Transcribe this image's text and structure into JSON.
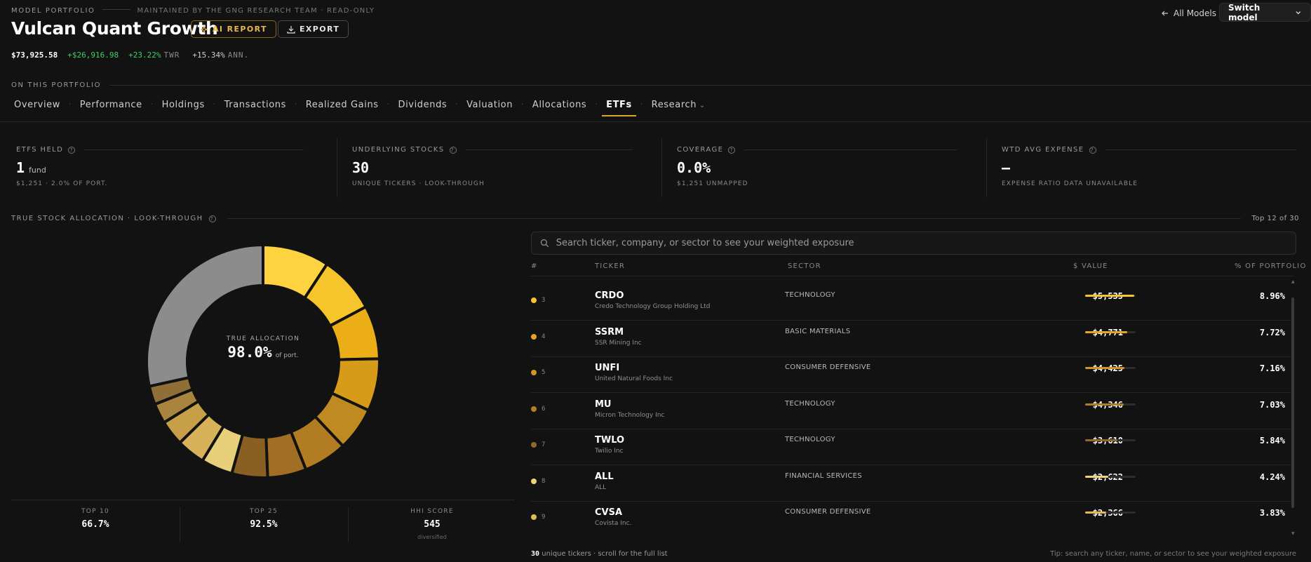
{
  "header": {
    "kicker": "MODEL PORTFOLIO",
    "maintained": "MAINTAINED BY THE GNG RESEARCH TEAM · READ-ONLY",
    "title": "Vulcan Quant Growth",
    "ai_report_label": "AI REPORT",
    "export_label": "EXPORT",
    "value": "$73,925.58",
    "gain": "+$26,916.98",
    "twr": "+23.22%",
    "twr_unit": "TWR",
    "ann": "+15.34%",
    "ann_unit": "ANN.",
    "back_label": "All Models",
    "switch_label": "Switch model"
  },
  "nav": {
    "section_label": "ON THIS PORTFOLIO",
    "tabs": [
      "Overview",
      "Performance",
      "Holdings",
      "Transactions",
      "Realized Gains",
      "Dividends",
      "Valuation",
      "Allocations",
      "ETFs",
      "Research"
    ],
    "active": "ETFs"
  },
  "kpis": [
    {
      "label": "ETFS HELD",
      "value": "1",
      "value_suffix": "fund",
      "sub": "$1,251 · 2.0% OF PORT."
    },
    {
      "label": "UNDERLYING STOCKS",
      "value": "30",
      "value_suffix": "",
      "sub": "UNIQUE TICKERS · LOOK-THROUGH"
    },
    {
      "label": "COVERAGE",
      "value": "0.0%",
      "value_suffix": "",
      "sub": "$1,251 UNMAPPED"
    },
    {
      "label": "WTD AVG EXPENSE",
      "value": "—",
      "value_suffix": "",
      "sub": "EXPENSE RATIO DATA UNAVAILABLE"
    }
  ],
  "allocation": {
    "section_label": "TRUE STOCK ALLOCATION · LOOK-THROUGH",
    "top_label": "Top 12 of 30",
    "center_label": "TRUE ALLOCATION",
    "center_value": "98.0%",
    "center_suffix": "of port.",
    "segments": [
      {
        "value": 8.96,
        "color": "#ffd23f"
      },
      {
        "value": 7.72,
        "color": "#f6c52c"
      },
      {
        "value": 7.16,
        "color": "#ecae17"
      },
      {
        "value": 7.03,
        "color": "#d79b1a"
      },
      {
        "value": 5.84,
        "color": "#c08a22"
      },
      {
        "value": 5.84,
        "color": "#b27d22"
      },
      {
        "value": 5.2,
        "color": "#a06f24"
      },
      {
        "value": 4.8,
        "color": "#8a5f22"
      },
      {
        "value": 4.24,
        "color": "#e8d07a"
      },
      {
        "value": 3.83,
        "color": "#d8b25a"
      },
      {
        "value": 3.4,
        "color": "#c79f48"
      },
      {
        "value": 2.7,
        "color": "#a8843f"
      },
      {
        "value": 2.5,
        "color": "#8f6e38"
      },
      {
        "value": 27.5,
        "color": "#8c8c8c"
      }
    ],
    "stats": [
      {
        "label": "TOP 10",
        "value": "66.7%",
        "sub": ""
      },
      {
        "label": "TOP 25",
        "value": "92.5%",
        "sub": ""
      },
      {
        "label": "HHI SCORE",
        "value": "545",
        "sub": "diversified"
      }
    ]
  },
  "table": {
    "search_placeholder": "Search ticker, company, or sector to see your weighted exposure",
    "columns": {
      "rank": "#",
      "ticker": "TICKER",
      "sector": "SECTOR",
      "value": "$ VALUE",
      "pct": "% OF PORTFOLIO"
    },
    "rows": [
      {
        "rank": "3",
        "ticker": "CRDO",
        "company": "Credo Technology Group Holding Ltd",
        "sector": "TECHNOLOGY",
        "value": "$5,535",
        "pct": "8.96%",
        "pct_num": 8.96,
        "color": "#f6c52c"
      },
      {
        "rank": "4",
        "ticker": "SSRM",
        "company": "SSR Mining Inc",
        "sector": "BASIC MATERIALS",
        "value": "$4,771",
        "pct": "7.72%",
        "pct_num": 7.72,
        "color": "#e5a51c"
      },
      {
        "rank": "5",
        "ticker": "UNFI",
        "company": "United Natural Foods Inc",
        "sector": "CONSUMER DEFENSIVE",
        "value": "$4,425",
        "pct": "7.16%",
        "pct_num": 7.16,
        "color": "#d39421"
      },
      {
        "rank": "6",
        "ticker": "MU",
        "company": "Micron Technology Inc",
        "sector": "TECHNOLOGY",
        "value": "$4,346",
        "pct": "7.03%",
        "pct_num": 7.03,
        "color": "#b17e25"
      },
      {
        "rank": "7",
        "ticker": "TWLO",
        "company": "Twilio Inc",
        "sector": "TECHNOLOGY",
        "value": "$3,610",
        "pct": "5.84%",
        "pct_num": 5.84,
        "color": "#8f6a2b"
      },
      {
        "rank": "8",
        "ticker": "ALL",
        "company": "ALL",
        "sector": "FINANCIAL SERVICES",
        "value": "$2,622",
        "pct": "4.24%",
        "pct_num": 4.24,
        "color": "#f1d276"
      },
      {
        "rank": "9",
        "ticker": "CVSA",
        "company": "Covista Inc.",
        "sector": "CONSUMER DEFENSIVE",
        "value": "$2,366",
        "pct": "3.83%",
        "pct_num": 3.83,
        "color": "#e3bb52"
      }
    ],
    "footer_count": "30",
    "footer_text": "unique tickers · scroll for the full list",
    "footer_tip": "Tip: search any ticker, name, or sector to see your weighted exposure"
  }
}
